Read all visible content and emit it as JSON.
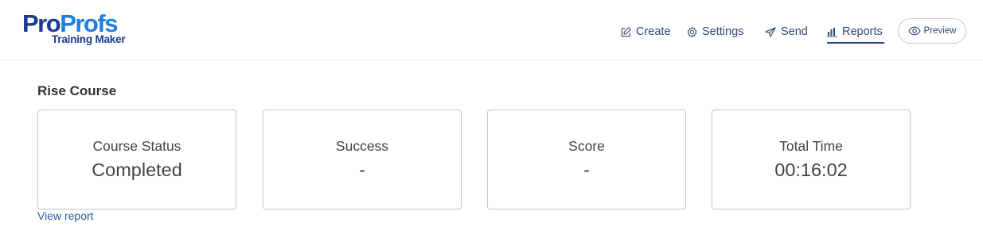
{
  "brand": {
    "logo_pro": "Pro",
    "logo_profs": "Profs",
    "logo_sub": "Training Maker"
  },
  "nav": {
    "create": "Create",
    "settings": "Settings",
    "send": "Send",
    "reports": "Reports",
    "preview": "Preview",
    "active": "Reports"
  },
  "course": {
    "title": "Rise Course"
  },
  "cards": [
    {
      "label": "Course Status",
      "value": "Completed"
    },
    {
      "label": "Success",
      "value": "-"
    },
    {
      "label": "Score",
      "value": "-"
    },
    {
      "label": "Total Time",
      "value": "00:16:02"
    }
  ],
  "links": {
    "view_report": "View report"
  },
  "colors": {
    "brand_dark": "#1b3a8c",
    "brand_light": "#1e7fe0",
    "nav_text": "#2d4a73",
    "link": "#2d5a9c"
  },
  "icons": {
    "create": "edit-icon",
    "settings": "gear-icon",
    "send": "send-icon",
    "reports": "bar-chart-icon",
    "preview": "eye-icon"
  }
}
